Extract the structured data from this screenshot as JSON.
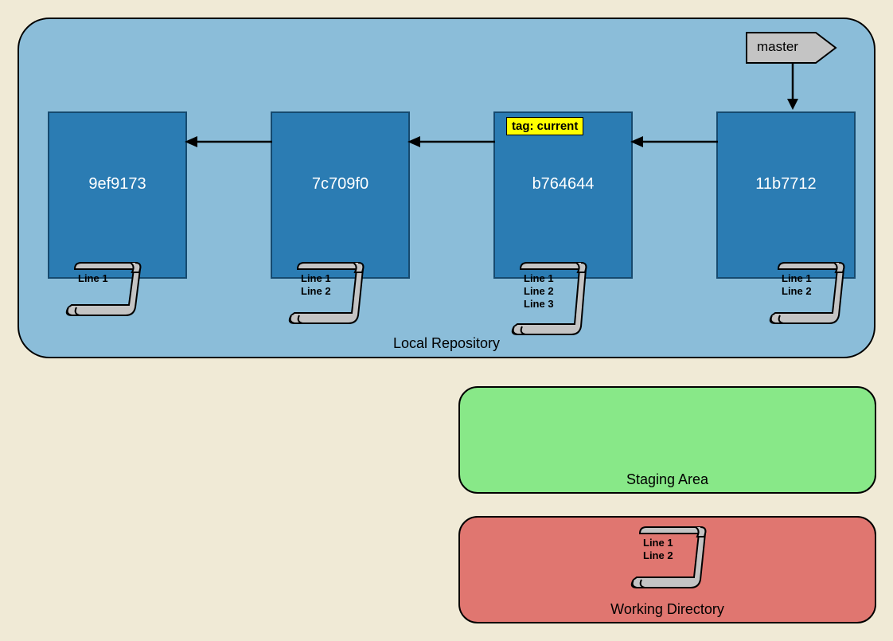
{
  "localRepo": {
    "label": "Local Repository"
  },
  "stagingArea": {
    "label": "Staging Area"
  },
  "workingDir": {
    "label": "Working Directory",
    "scroll": "Line 1\nLine 2"
  },
  "branch": {
    "name": "master"
  },
  "tag": {
    "label": "tag: current"
  },
  "commits": [
    {
      "hash": "9ef9173",
      "scroll": "Line 1"
    },
    {
      "hash": "7c709f0",
      "scroll": "Line 1\nLine 2"
    },
    {
      "hash": "b764644",
      "scroll": "Line 1\nLine 2\nLine 3"
    },
    {
      "hash": "11b7712",
      "scroll": "Line 1\nLine 2"
    }
  ]
}
